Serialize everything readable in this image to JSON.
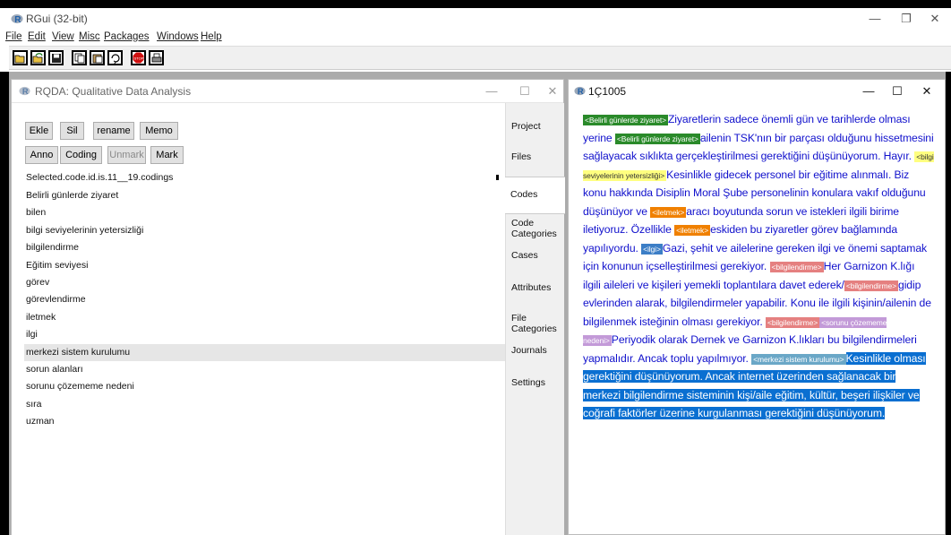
{
  "app": {
    "title": "RGui (32-bit)",
    "menu": [
      "File",
      "Edit",
      "View",
      "Misc",
      "Packages",
      "Windows",
      "Help"
    ],
    "toolbar_icons": [
      "open-script-icon",
      "load-workspace-icon",
      "save-icon",
      "copy-icon",
      "paste-icon",
      "copy-paste-icon",
      "stop-icon",
      "print-icon"
    ],
    "stop_label": "STOP"
  },
  "rqda": {
    "title": "RQDA: Qualitative Data Analysis",
    "buttons_row1": [
      "Ekle",
      "Sil",
      "rename",
      "Memo"
    ],
    "buttons_row2": [
      "Anno",
      "Coding",
      "Unmark",
      "Mark"
    ],
    "codings_label": "Selected.code.id.is.11__19.codings",
    "codes": [
      "Belirli günlerde ziyaret",
      "bilen",
      "bilgi seviyelerinin yetersizliği",
      "bilgilendirme",
      "Eğitim seviyesi",
      "görev",
      "görevlendirme",
      "iletmek",
      "ilgi",
      "merkezi sistem kurulumu",
      "sorun alanları",
      "sorunu çözememe nedeni",
      "sıra",
      "uzman"
    ],
    "selected_code": "merkezi sistem kurulumu",
    "tabs": [
      "Project",
      "Files",
      "Codes",
      "Code Categories",
      "Cases",
      "Attributes",
      "File Categories",
      "Journals",
      "Settings"
    ],
    "active_tab": "Codes"
  },
  "doc": {
    "title": "1Ç1005",
    "markers": {
      "m1": "<Belirli günlerde ziyaret>",
      "m2": "<Belirli günlerde ziyaret>",
      "m3": "<bilgi seviyelerinin yetersizliği>",
      "m4": "<iletmek>",
      "m5": "<iletmek>",
      "m6": "<ilgi>",
      "m7": "<bilgilendirme>",
      "m8": "<bilgilendirme>",
      "m9": "<bilgilendirme>",
      "m10": "<sorunu çözememe nedeni>",
      "m11": "<merkezi sistem kurulumu>"
    },
    "segments": {
      "s1": "Ziyaretlerin sadece önemli gün ve tarihlerde olması yerine ",
      "s2": "ailenin TSK'nın bir parçası olduğunu hissetmesini sağlayacak sıklıkta gerçekleştirilmesi gerektiğini düşünüyorum.  Hayır. ",
      "s3": "Kesinlikle gidecek personel bir eğitime alınmalı.  Biz konu hakkında Disiplin Moral Şube personelinin konulara vakıf olduğunu düşünüyor ve ",
      "s4": "aracı boyutunda sorun ve istekleri ilgili birime iletiyoruz.    Özellikle ",
      "s5": "eskiden bu ziyaretler görev bağlamında yapılıyordu. ",
      "s6": "Gazi, şehit ve ailelerine gereken ilgi ve önemi saptamak için konunun içselleştirilmesi gerekiyor.     ",
      "s7": "Her Garnizon K.lığı ilgili aileleri ve kişileri yemekli toplantılara davet ederek/",
      "s8": "gidip evlerinden alarak",
      "s9": ", bilgilendirmeler yapabilir.  Konu ile ilgili kişinin/ailenin de bilgilenmek isteğinin olması gerekiyor. ",
      "s10": "Periyodik olarak Dernek ve Garnizon K.lıkları bu bilgilendirmeleri yapmalıdır. Ancak toplu yapılmıyor.   ",
      "s11": "Kesinlikle olması gerektiğini düşünüyorum. Ancak internet üzerinden sağlanacak bir merkezi bilgilendirme sisteminin kişi/aile eğitim, kültür, beşeri ilişkiler ve coğrafi faktörler üzerine kurgulanması gerektiğini düşünüyorum."
    }
  }
}
